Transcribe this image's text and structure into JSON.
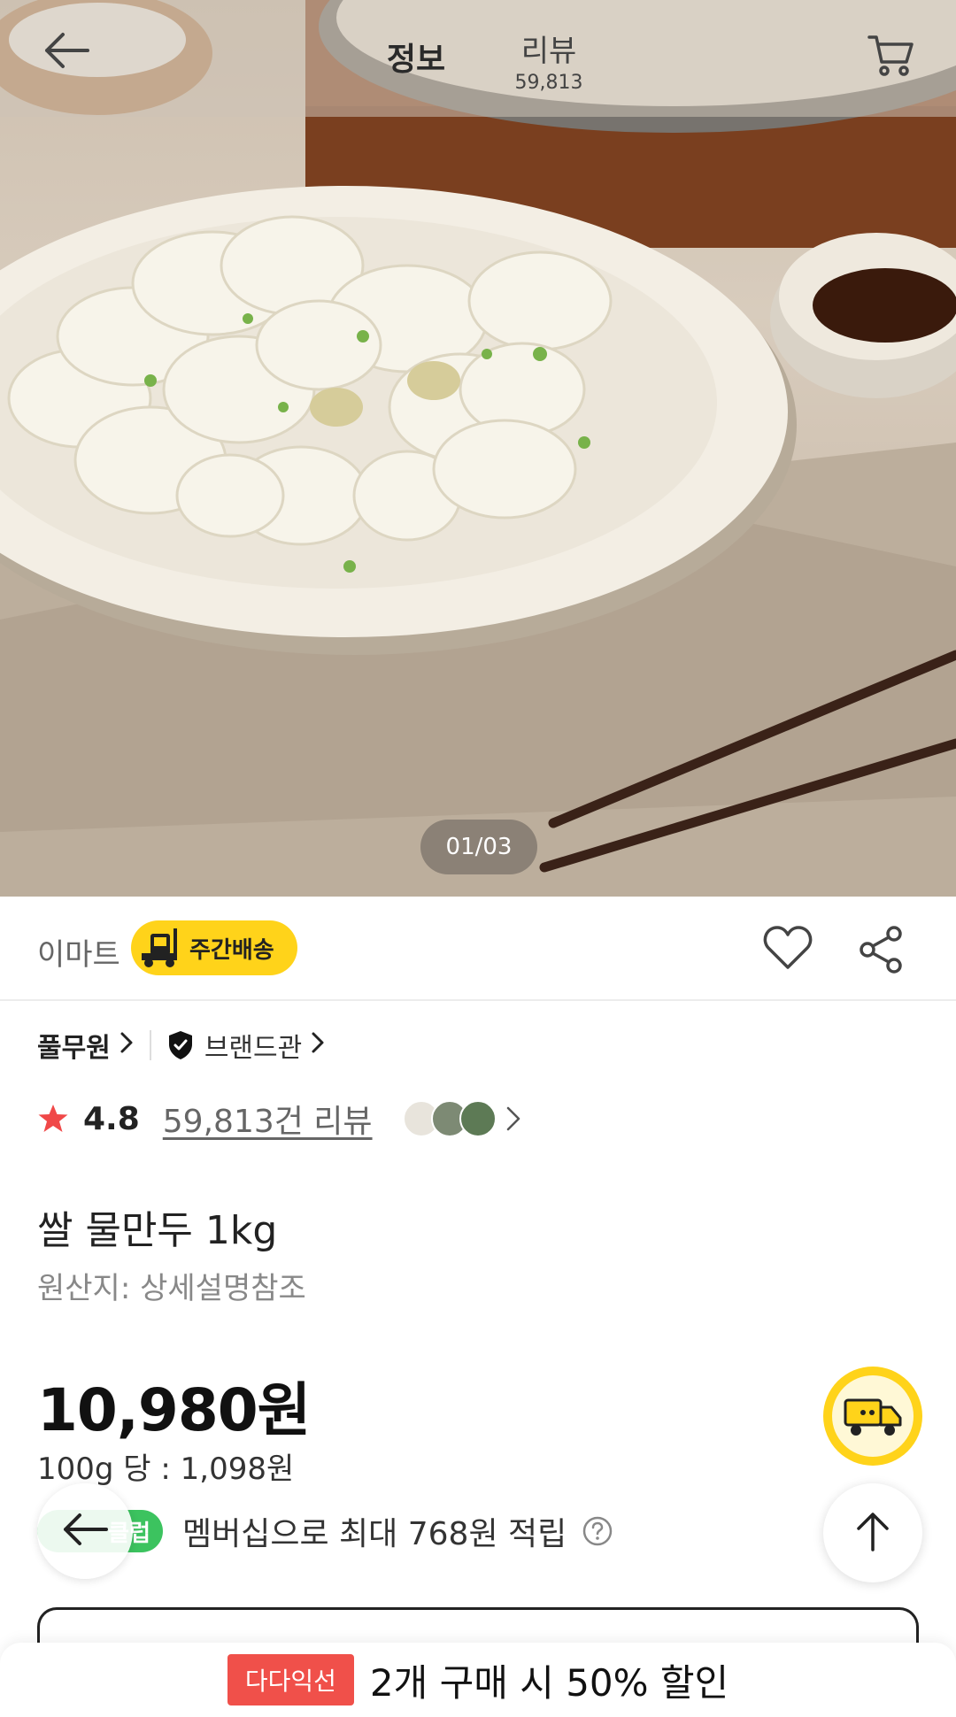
{
  "header": {
    "tab_info": "정보",
    "tab_review": "리뷰",
    "review_count": "59,813"
  },
  "gallery": {
    "pager": "01/03"
  },
  "seller": {
    "name": "이마트",
    "delivery_badge": "주간배송"
  },
  "brand": {
    "name": "풀무원",
    "brandshop_label": "브랜드관"
  },
  "rating": {
    "value": "4.8",
    "review_link": "59,813건 리뷰"
  },
  "product": {
    "title": "쌀 물만두 1kg",
    "origin": "원산지: 상세설명참조"
  },
  "price": {
    "amount": "10,980원",
    "unit_price": "100g 당 : 1,098원"
  },
  "membership": {
    "badge": "클럽",
    "text": "멤버십으로 최대 768원 적립"
  },
  "promo": {
    "tag": "다다익선",
    "text": "2개 구매 시 50% 할인"
  },
  "colors": {
    "accent_yellow": "#ffd31a",
    "star_red": "#f04848",
    "club_green": "#3cc35f",
    "promo_red": "#f0504a"
  }
}
